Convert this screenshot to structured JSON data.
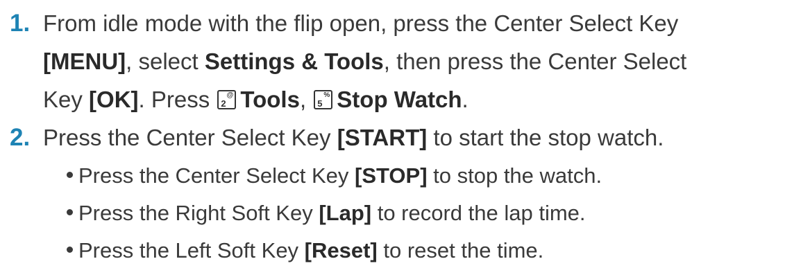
{
  "step1": {
    "number": "1.",
    "line1_text": "From idle mode with the flip open, press the Center Select Key",
    "line2_menu": "[MENU]",
    "line2_mid": ", select ",
    "line2_settings": "Settings & Tools",
    "line2_end": ", then press the Center Select",
    "line3_key": "Key ",
    "line3_ok": "[OK]",
    "line3_press": ". Press ",
    "key2_num": "2",
    "key2_sym": "@",
    "tools": "Tools",
    "comma": ",",
    "key5_num": "5",
    "key5_sym": "%",
    "stopwatch": "Stop Watch",
    "period": "."
  },
  "step2": {
    "number": "2.",
    "text_pre": "Press the Center Select Key ",
    "start": "[START]",
    "text_post": " to start the stop watch."
  },
  "bullets": [
    {
      "pre": "Press the Center Select Key ",
      "key": "[STOP]",
      "post": " to stop the watch."
    },
    {
      "pre": "Press the Right Soft Key ",
      "key": "[Lap]",
      "post": " to record the lap time."
    },
    {
      "pre": "Press the Left Soft Key ",
      "key": "[Reset]",
      "post": " to reset the time."
    }
  ]
}
